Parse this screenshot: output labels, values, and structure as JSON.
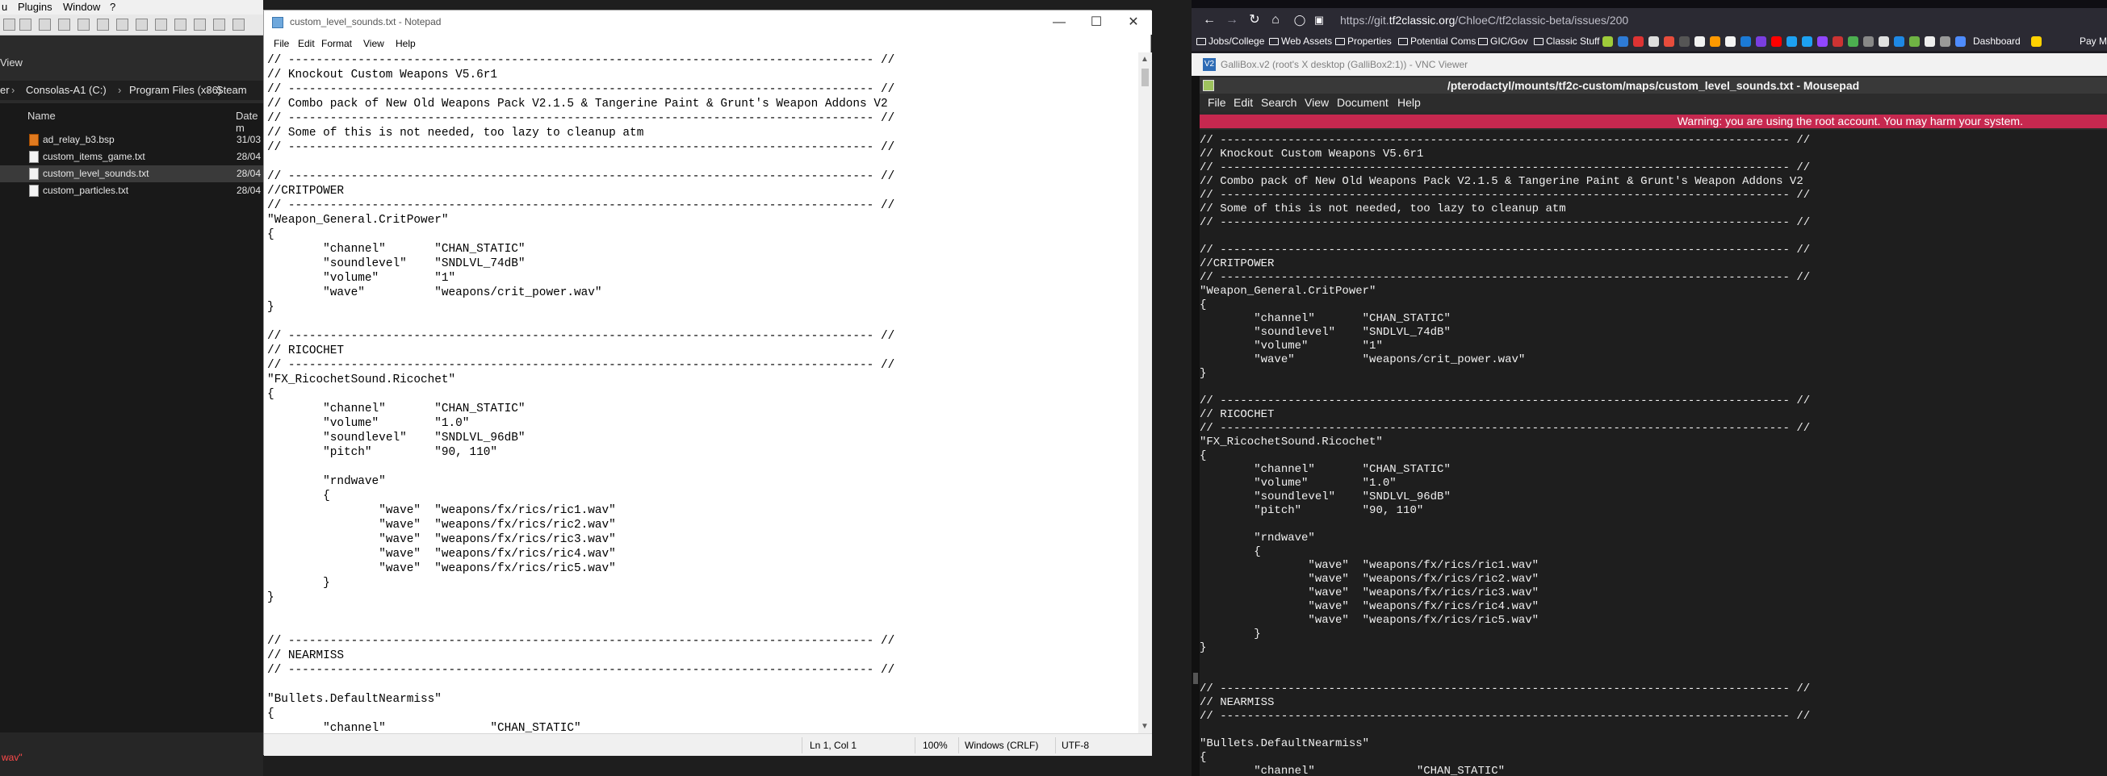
{
  "left_app": {
    "menu": [
      "u",
      "Plugins",
      "Window",
      "?"
    ],
    "view_label": "View",
    "path": [
      "er",
      "Consolas-A1 (C:)",
      "Program Files (x86)",
      "Steam"
    ],
    "col_name": "Name",
    "col_date": "Date m",
    "files": [
      {
        "name": "ad_relay_b3.bsp",
        "date": "31/03"
      },
      {
        "name": "custom_items_game.txt",
        "date": "28/04"
      },
      {
        "name": "custom_level_sounds.txt",
        "date": "28/04"
      },
      {
        "name": "custom_particles.txt",
        "date": "28/04"
      }
    ],
    "bottom_error": "wav\""
  },
  "notepad": {
    "title": "custom_level_sounds.txt - Notepad",
    "menu": [
      "File",
      "Edit",
      "Format",
      "View",
      "Help"
    ],
    "content": "// ------------------------------------------------------------------------------------ //\n// Knockout Custom Weapons V5.6r1\n// ------------------------------------------------------------------------------------ //\n// Combo pack of New Old Weapons Pack V2.1.5 & Tangerine Paint & Grunt's Weapon Addons V2\n// ------------------------------------------------------------------------------------ //\n// Some of this is not needed, too lazy to cleanup atm\n// ------------------------------------------------------------------------------------ //\n\n// ------------------------------------------------------------------------------------ //\n//CRITPOWER\n// ------------------------------------------------------------------------------------ //\n\"Weapon_General.CritPower\"\n{\n\t\"channel\"\t\"CHAN_STATIC\"\n\t\"soundlevel\"\t\"SNDLVL_74dB\"\n\t\"volume\"\t\"1\"\n\t\"wave\"\t\t\"weapons/crit_power.wav\"\n}\n\n// ------------------------------------------------------------------------------------ //\n// RICOCHET\n// ------------------------------------------------------------------------------------ //\n\"FX_RicochetSound.Ricochet\"\n{\n\t\"channel\"\t\"CHAN_STATIC\"\n\t\"volume\"\t\"1.0\"\n\t\"soundlevel\"\t\"SNDLVL_96dB\"\n\t\"pitch\"\t\t\"90, 110\"\n\n\t\"rndwave\"\n\t{\n\t\t\"wave\"\t\"weapons/fx/rics/ric1.wav\"\n\t\t\"wave\"\t\"weapons/fx/rics/ric2.wav\"\n\t\t\"wave\"\t\"weapons/fx/rics/ric3.wav\"\n\t\t\"wave\"\t\"weapons/fx/rics/ric4.wav\"\n\t\t\"wave\"\t\"weapons/fx/rics/ric5.wav\"\n\t}\n}\n\n\n// ------------------------------------------------------------------------------------ //\n// NEARMISS\n// ------------------------------------------------------------------------------------ //\n\n\"Bullets.DefaultNearmiss\"\n{\n\t\"channel\"\t\t\"CHAN_STATIC\"",
    "status": {
      "position": "Ln 1, Col 1",
      "zoom": "100%",
      "line_endings": "Windows (CRLF)",
      "encoding": "UTF-8"
    }
  },
  "browser": {
    "url_prefix": "https://git.",
    "url_host": "tf2classic.org",
    "url_rest": "/ChloeC/tf2classic-beta/issues/200",
    "bookmarks": [
      "Jobs/College",
      "Web Assets",
      "Properties",
      "Potential Coms",
      "GIC/Gov",
      "Classic Stuff",
      "Dashboard",
      "Pay M"
    ]
  },
  "vnc": {
    "window_title": "GalliBox.v2 (root's X desktop (GalliBox2:1)) - VNC Viewer",
    "mousepad_title": "/pterodactyl/mounts/tf2c-custom/maps/custom_level_sounds.txt - Mousepad",
    "menu": [
      "File",
      "Edit",
      "Search",
      "View",
      "Document",
      "Help"
    ],
    "warning": "Warning: you are using the root account. You may harm your system.",
    "content": "// ------------------------------------------------------------------------------------ //\n// Knockout Custom Weapons V5.6r1\n// ------------------------------------------------------------------------------------ //\n// Combo pack of New Old Weapons Pack V2.1.5 & Tangerine Paint & Grunt's Weapon Addons V2\n// ------------------------------------------------------------------------------------ //\n// Some of this is not needed, too lazy to cleanup atm\n// ------------------------------------------------------------------------------------ //\n\n// ------------------------------------------------------------------------------------ //\n//CRITPOWER\n// ------------------------------------------------------------------------------------ //\n\"Weapon_General.CritPower\"\n{\n\t\"channel\"\t\"CHAN_STATIC\"\n\t\"soundlevel\"\t\"SNDLVL_74dB\"\n\t\"volume\"\t\"1\"\n\t\"wave\"\t\t\"weapons/crit_power.wav\"\n}\n\n// ------------------------------------------------------------------------------------ //\n// RICOCHET\n// ------------------------------------------------------------------------------------ //\n\"FX_RicochetSound.Ricochet\"\n{\n\t\"channel\"\t\"CHAN_STATIC\"\n\t\"volume\"\t\"1.0\"\n\t\"soundlevel\"\t\"SNDLVL_96dB\"\n\t\"pitch\"\t\t\"90, 110\"\n\n\t\"rndwave\"\n\t{\n\t\t\"wave\"\t\"weapons/fx/rics/ric1.wav\"\n\t\t\"wave\"\t\"weapons/fx/rics/ric2.wav\"\n\t\t\"wave\"\t\"weapons/fx/rics/ric3.wav\"\n\t\t\"wave\"\t\"weapons/fx/rics/ric4.wav\"\n\t\t\"wave\"\t\"weapons/fx/rics/ric5.wav\"\n\t}\n}\n\n\n// ------------------------------------------------------------------------------------ //\n// NEARMISS\n// ------------------------------------------------------------------------------------ //\n\n\"Bullets.DefaultNearmiss\"\n{\n\t\"channel\"\t\t\"CHAN_STATIC\""
  },
  "colors": {
    "warning_bg": "#c6284f",
    "dark_editor_bg": "#1e1e1e",
    "browser_chrome": "#2b2a33"
  }
}
